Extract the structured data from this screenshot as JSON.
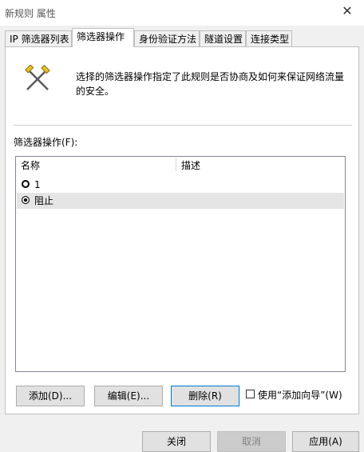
{
  "window": {
    "title": "新规则 属性",
    "close_symbol": "✕"
  },
  "tabs": [
    {
      "label": "IP 筛选器列表",
      "active": false
    },
    {
      "label": "筛选器操作",
      "active": true
    },
    {
      "label": "身份验证方法",
      "active": false
    },
    {
      "label": "隧道设置",
      "active": false
    },
    {
      "label": "连接类型",
      "active": false
    }
  ],
  "panel": {
    "icon": "filter-action-icon",
    "description": "选择的筛选器操作指定了此规则是否协商及如何来保证网络流量的安全。",
    "list_label": "筛选器操作(F):",
    "columns": [
      "名称",
      "描述"
    ],
    "rows": [
      {
        "name": "1",
        "description": "",
        "checked": false,
        "selected": false
      },
      {
        "name": "阻止",
        "description": "",
        "checked": true,
        "selected": true
      }
    ],
    "buttons": {
      "add": "添加(D)...",
      "edit": "编辑(E)...",
      "delete": "删除(R)"
    },
    "wizard_checkbox": {
      "label": "使用“添加向导”(W)",
      "checked": false
    }
  },
  "footer": {
    "close": "关闭",
    "cancel": "取消",
    "apply": "应用(A)"
  },
  "colors": {
    "accent": "#0078d7",
    "selected_row": "#e5e5e5"
  }
}
